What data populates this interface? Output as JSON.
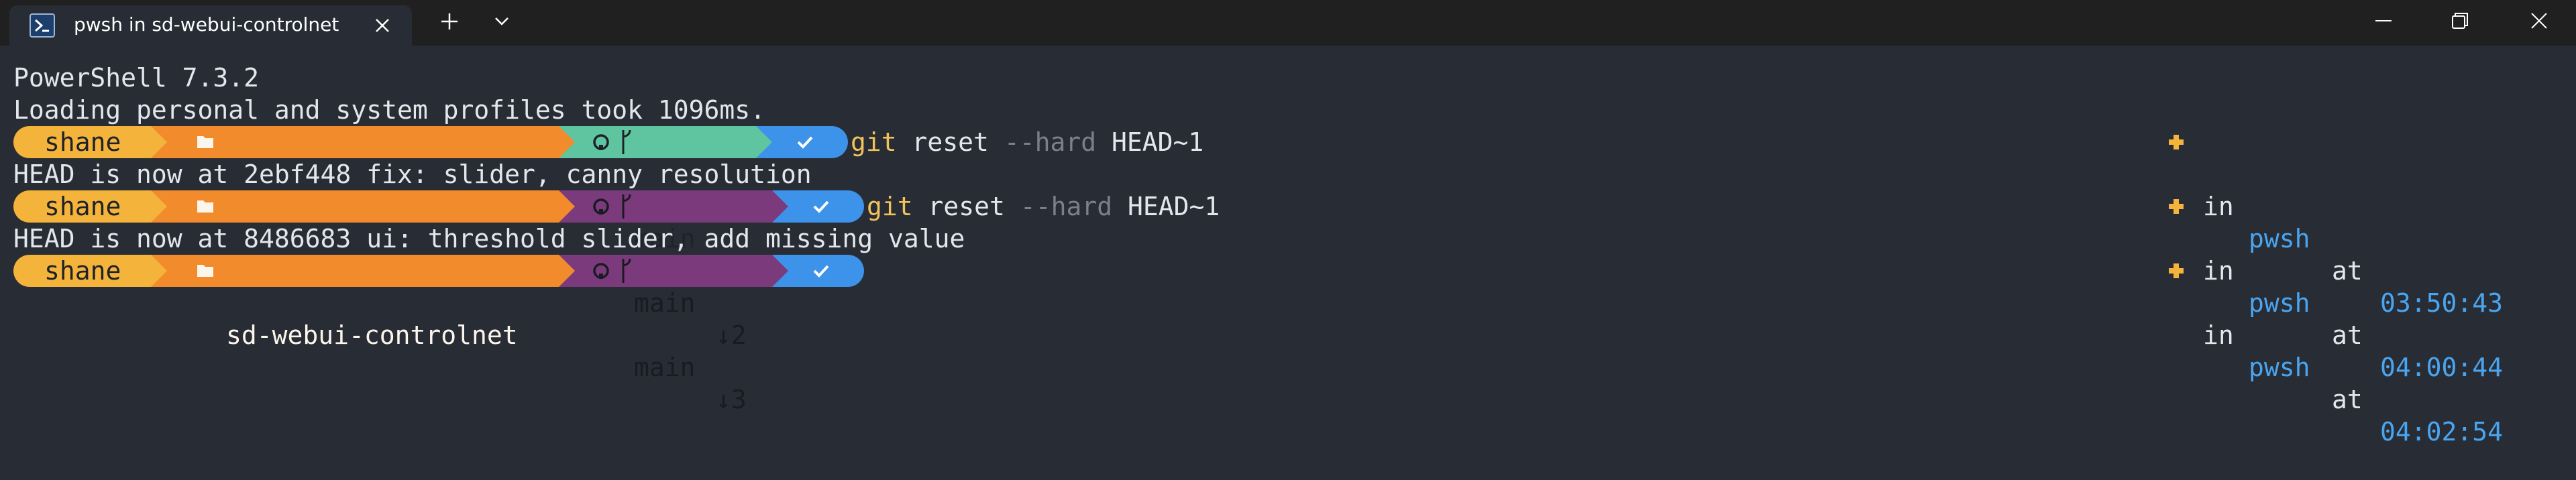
{
  "tab": {
    "title": "pwsh in sd-webui-controlnet"
  },
  "colors": {
    "background": "#282c34",
    "user_segment": "#f4b33a",
    "path_segment": "#f28b2b",
    "git_clean_segment": "#5fc4a0",
    "git_dirty_segment": "#7b3a7c",
    "status_segment": "#3d92ea",
    "command_git": "#f2c25b",
    "shell_time": "#4aa5f0"
  },
  "output": {
    "line1": "PowerShell 7.3.2",
    "line2": "Loading personal and system profiles took 1096ms.",
    "line3": "HEAD is now at 2ebf448 fix: slider, canny resolution",
    "line4": "HEAD is now at 8486683 ui: threshold slider, add missing value"
  },
  "prompts": [
    {
      "user": "shane",
      "path": "sd-webui-controlnet",
      "branch": "main",
      "branch_status": "≡",
      "command": {
        "git": "git",
        "sub": "reset",
        "flag": "--hard",
        "arg": "HEAD~1"
      },
      "right": {
        "in": "in",
        "shell": "pwsh",
        "at": "at",
        "time": "03:50:43"
      }
    },
    {
      "user": "shane",
      "path": "sd-webui-controlnet",
      "branch": "main",
      "branch_status": "↓2",
      "command": {
        "git": "git",
        "sub": "reset",
        "flag": "--hard",
        "arg": "HEAD~1"
      },
      "right": {
        "in": "in",
        "shell": "pwsh",
        "at": "at",
        "time": "04:00:44"
      }
    },
    {
      "user": "shane",
      "path": "sd-webui-controlnet",
      "branch": "main",
      "branch_status": "↓3",
      "right": {
        "in": "in",
        "shell": "pwsh",
        "at": "at",
        "time": "04:02:54"
      }
    }
  ],
  "icons": {
    "tab": "powershell-icon",
    "close": "close-icon",
    "new_tab": "plus-icon",
    "dropdown": "chevron-down-icon",
    "folder": "folder-icon",
    "github": "github-icon",
    "branch": "branch-icon",
    "status": "check-icon",
    "root": "plus-badge-icon"
  }
}
